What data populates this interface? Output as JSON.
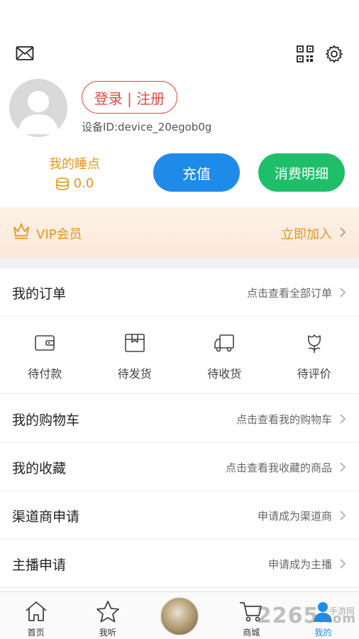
{
  "header": {
    "icons": [
      "mail-icon",
      "qr-code-icon",
      "gear-icon"
    ]
  },
  "profile": {
    "login_label": "登录 | 注册",
    "device_id": "设备ID:device_20egob0g",
    "avatar_icon": "default-avatar-icon"
  },
  "points": {
    "label": "我的睡点",
    "value": "0.0",
    "icon": "coins-icon"
  },
  "actions": {
    "recharge_label": "充值",
    "details_label": "消费明细"
  },
  "vip": {
    "label": "VIP会员",
    "join_label": "立即加入",
    "icon": "crown-icon"
  },
  "orders": {
    "title": "我的订单",
    "hint": "点击查看全部订单",
    "statuses": [
      {
        "label": "待付款",
        "icon": "wallet-icon"
      },
      {
        "label": "待发货",
        "icon": "package-icon"
      },
      {
        "label": "待收货",
        "icon": "truck-icon"
      },
      {
        "label": "待评价",
        "icon": "flower-icon"
      }
    ]
  },
  "menu": [
    {
      "title": "我的购物车",
      "hint": "点击查看我的购物车"
    },
    {
      "title": "我的收藏",
      "hint": "点击查看我收藏的商品"
    },
    {
      "title": "渠道商申请",
      "hint": "申请成为渠道商"
    },
    {
      "title": "主播申请",
      "hint": "申请成为主播"
    }
  ],
  "tabbar": {
    "tabs": [
      {
        "label": "首页",
        "icon": "home-icon"
      },
      {
        "label": "我听",
        "icon": "star-icon"
      },
      {
        "label": "",
        "icon": "center-album-icon"
      },
      {
        "label": "商城",
        "icon": "cart-icon"
      },
      {
        "label": "我的",
        "icon": "user-icon"
      }
    ],
    "active_color": "#1f8be8"
  },
  "watermark": {
    "text": "2265",
    "sub": "手游网",
    "domain": ".com"
  },
  "colors": {
    "accent_red": "#e2483d",
    "accent_orange": "#e8941a",
    "blue": "#1f8be8",
    "green": "#1fbf6a"
  }
}
